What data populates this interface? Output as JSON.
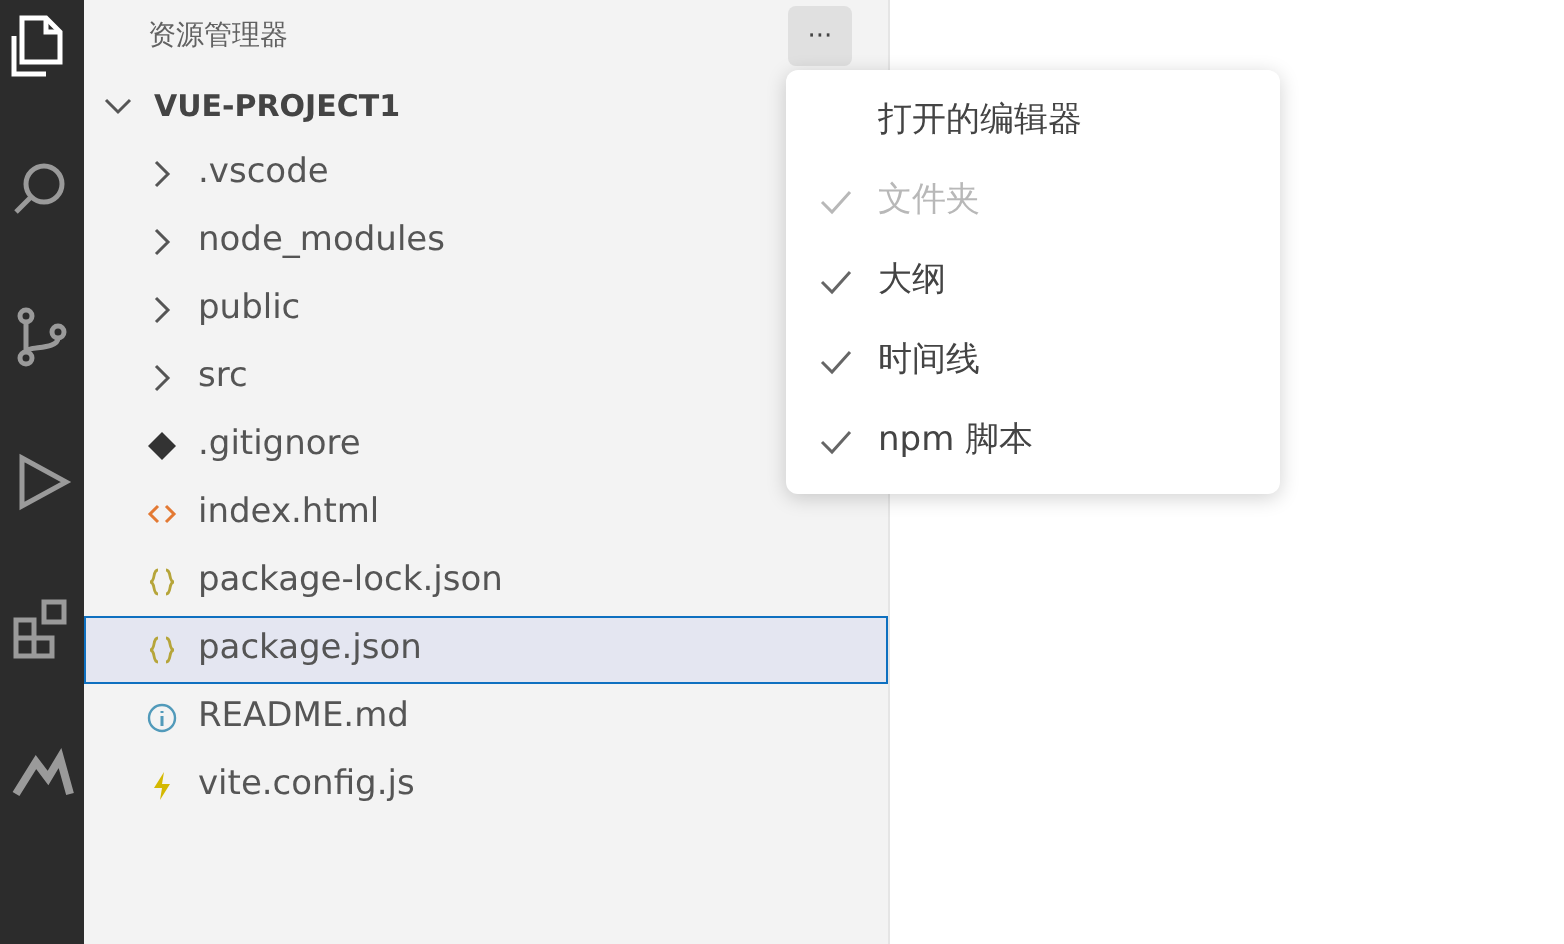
{
  "activity_bar": {
    "items": [
      {
        "kind": "files",
        "selected": true
      },
      {
        "kind": "search",
        "selected": false
      },
      {
        "kind": "source-control",
        "selected": false
      },
      {
        "kind": "run",
        "selected": false
      },
      {
        "kind": "extensions",
        "selected": false
      },
      {
        "kind": "remote",
        "selected": false
      }
    ]
  },
  "sidebar": {
    "title": "资源管理器",
    "more_button": "···",
    "tree": [
      {
        "label": "VUE-PROJECT1",
        "kind": "root",
        "expanded": true,
        "selected": false,
        "children": [
          {
            "label": ".vscode",
            "kind": "folder",
            "expanded": false,
            "selected": false
          },
          {
            "label": "node_modules",
            "kind": "folder",
            "expanded": false,
            "selected": false
          },
          {
            "label": "public",
            "kind": "folder",
            "expanded": false,
            "selected": false
          },
          {
            "label": "src",
            "kind": "folder",
            "expanded": false,
            "selected": false
          },
          {
            "label": ".gitignore",
            "kind": "git",
            "selected": false
          },
          {
            "label": "index.html",
            "kind": "html",
            "selected": false
          },
          {
            "label": "package-lock.json",
            "kind": "json",
            "selected": false
          },
          {
            "label": "package.json",
            "kind": "json",
            "selected": true
          },
          {
            "label": "README.md",
            "kind": "info",
            "selected": false
          },
          {
            "label": "vite.config.js",
            "kind": "vite",
            "selected": false
          }
        ]
      }
    ]
  },
  "context_menu": {
    "items": [
      {
        "label": "打开的编辑器",
        "checked": false,
        "disabled": false
      },
      {
        "label": "文件夹",
        "checked": true,
        "disabled": true
      },
      {
        "label": "大纲",
        "checked": true,
        "disabled": false
      },
      {
        "label": "时间线",
        "checked": true,
        "disabled": false
      },
      {
        "label": "npm 脚本",
        "checked": true,
        "disabled": false
      }
    ]
  }
}
